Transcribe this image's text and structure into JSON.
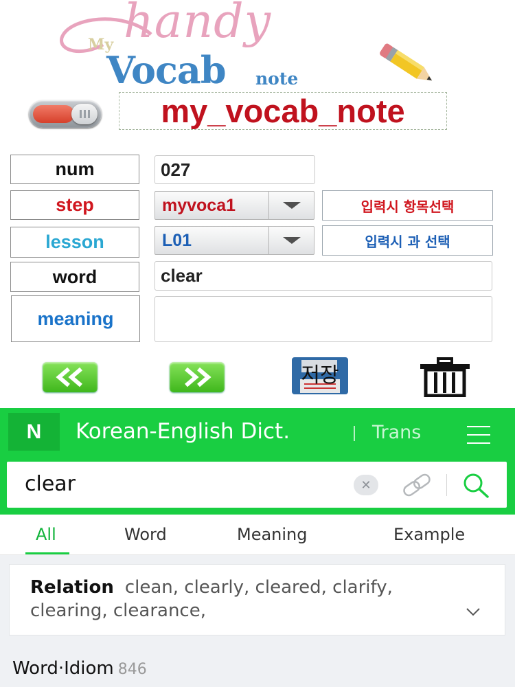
{
  "logo": {
    "my": "My",
    "handy": "handy",
    "vocab": "Vocab",
    "note": "note"
  },
  "app_title": "my_vocab_note",
  "toggle": {
    "state": "off"
  },
  "form": {
    "num": {
      "label": "num",
      "value": "027",
      "label_color": "#111111"
    },
    "step": {
      "label": "step",
      "value": "myvoca1",
      "hint": "입력시 항목선택",
      "label_color": "#d0161e",
      "value_color": "#c0121e",
      "hint_color": "#d0161e"
    },
    "lesson": {
      "label": "lesson",
      "value": "L01",
      "hint": "입력시 과 선택",
      "label_color": "#2aa7d2",
      "value_color": "#1c5fb5",
      "hint_color": "#1c5fb5"
    },
    "word": {
      "label": "word",
      "value": "clear",
      "label_color": "#111111"
    },
    "meaning": {
      "label": "meaning",
      "value": "",
      "label_color": "#1a73c9"
    }
  },
  "actions": {
    "prev_icon": "double-chevron-left-icon",
    "next_icon": "double-chevron-right-icon",
    "save_label": "저장",
    "delete_icon": "trash-icon"
  },
  "dictionary": {
    "logo": "N",
    "title": "Korean-English Dict.",
    "trans": "Trans",
    "search_value": "clear",
    "tabs": [
      {
        "label": "All",
        "active": true
      },
      {
        "label": "Word",
        "active": false
      },
      {
        "label": "Meaning",
        "active": false
      },
      {
        "label": "Example",
        "active": false
      }
    ],
    "relation": {
      "heading": "Relation",
      "line1": "clean, clearly, cleared, clarify,",
      "line2": "clearing, clearance,"
    },
    "section": {
      "title": "Word·Idiom",
      "count": "846"
    },
    "accent": "#19ce42"
  }
}
